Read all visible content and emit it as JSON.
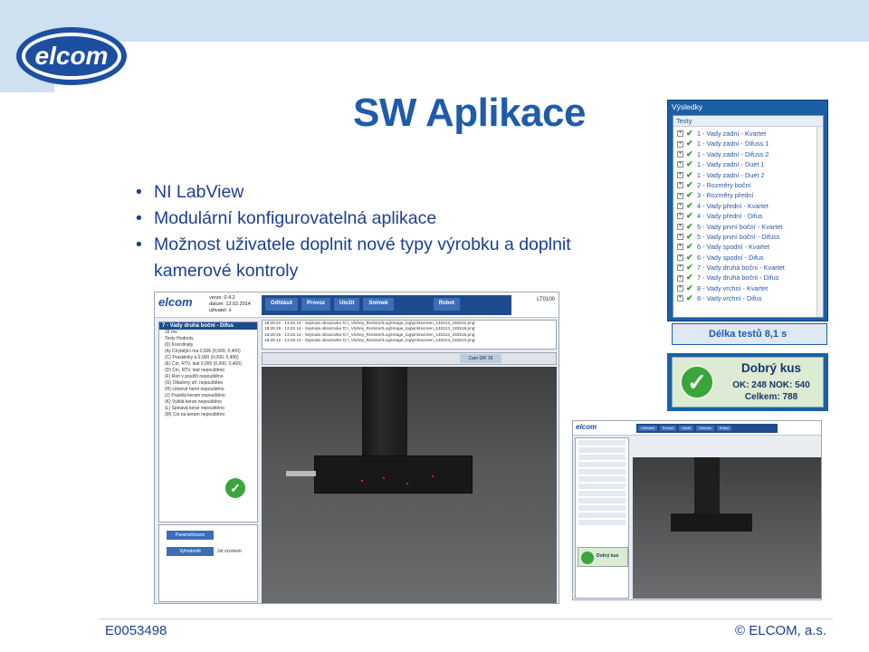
{
  "slide": {
    "title": "SW Aplikace",
    "bullets": [
      "NI LabView",
      "Modulární konfigurovatelná aplikace",
      "Možnost uživatele doplnit nové typy výrobku a doplnit kamerové kontroly"
    ],
    "logo_text": "elcom",
    "footer_left": "E0053498",
    "footer_right": "© ELCOM, a.s."
  },
  "results_panel": {
    "title": "Výsledky",
    "tests_header": "Testy",
    "tests": [
      "1 - Vady zadní - Kvartet",
      "1 - Vady zadní - Difuss 1",
      "1 - Vady zadní - Difuss 2",
      "1 - Vady zadní - Duet 1",
      "1 - Vady zadní - Duet 2",
      "2 - Rozměry boční",
      "3 - Rozměry přední",
      "4 - Vady přední - Kvartet",
      "4 - Vady přední - Difus",
      "5 - Vady první boční - Kvartet",
      "5 - Vady první boční - Difuss",
      "6 - Vady spodní - Kvartet",
      "6 - Vady spodní - Difus",
      "7 - Vady druhá boční - Kvartet",
      "7 - Vady druhá boční - Difus",
      "8 - Vady vrchní - Kvartet",
      "8 - Vady vrchní - Difus"
    ],
    "duration": "Délka testů 8,1 s",
    "verdict": "Dobrý kus",
    "ok_nok": "OK: 248 NOK: 540",
    "total": "Celkem: 788",
    "colors": {
      "panel": "#1b5fa6",
      "ok": "#3aa53a",
      "text": "#17366e"
    }
  },
  "main_app": {
    "logo": "elcom",
    "meta": [
      "verze: 0.4.2",
      "datum: 12.02.2014",
      "uživatel: x"
    ],
    "tabs": [
      "Odhlásit",
      "Provoz",
      "Uložit",
      "Snímek",
      "Robot"
    ],
    "station_code": "LT0100",
    "left_title": "7 - Vady druhá boční - Difus",
    "left_rows": [
      "16 ms",
      "Testy        Hodnoty",
      "(0) Koordináty",
      "(A) Chybějící ma  0,006 (0,000, 0,400)",
      "(C) Prasklinky a   0,000 (0,000, 0,400)",
      "(E) Cin, RTV, leal 0,000 (0,000, 0,400)",
      "(D) Cin, RTV, leal nepouštěno",
      "(F) Ron v použití  nepouštěno",
      "(G) Otlačeny stř. nepouštěno",
      "(H) Litinové herni nepouštěno",
      "(J) Prasklá keram nepouštěno",
      "(K) Vylítlá keran  nepouštěno",
      "(L) Špinavá kerar nepouštěno",
      "(M) Cin na keram nepouštěno"
    ],
    "log_rows": [
      "18:25:21 - 13.02.14 - Sejmuta obrazovka 'D:\\_Vlohey_Rezistor\\Log\\Image_log\\printscreen_140213_182531.png'",
      "18:25:19 - 13.02.14 - Sejmuta obrazovka 'D:\\_Vlohey_Rezistor\\Log\\Image_log\\printscreen_140213_182518.png'",
      "18:25:15 - 13.02.14 - Sejmuta obrazovka 'D:\\_Vlohey_Rezistor\\Log\\Image_log\\printscreen_140213_182515.png'",
      "18:25:12 - 13.02.14 - Sejmuta obrazovka 'D:\\_Vlohey_Rezistor\\Log\\Image_log\\printscreen_140213_182512.png'"
    ],
    "camera_selector": "Cam DIF 16",
    "foot_buttons": [
      "Parametrizace",
      "Vyhodnotit"
    ],
    "foot_checkbox": "Jet vzorkem"
  },
  "secondary_app": {
    "logo": "elcom",
    "tabs": [
      "Odhlásit",
      "Provoz",
      "Uložit",
      "Snímek",
      "Robot"
    ],
    "verdict": "Dobrý kus"
  }
}
